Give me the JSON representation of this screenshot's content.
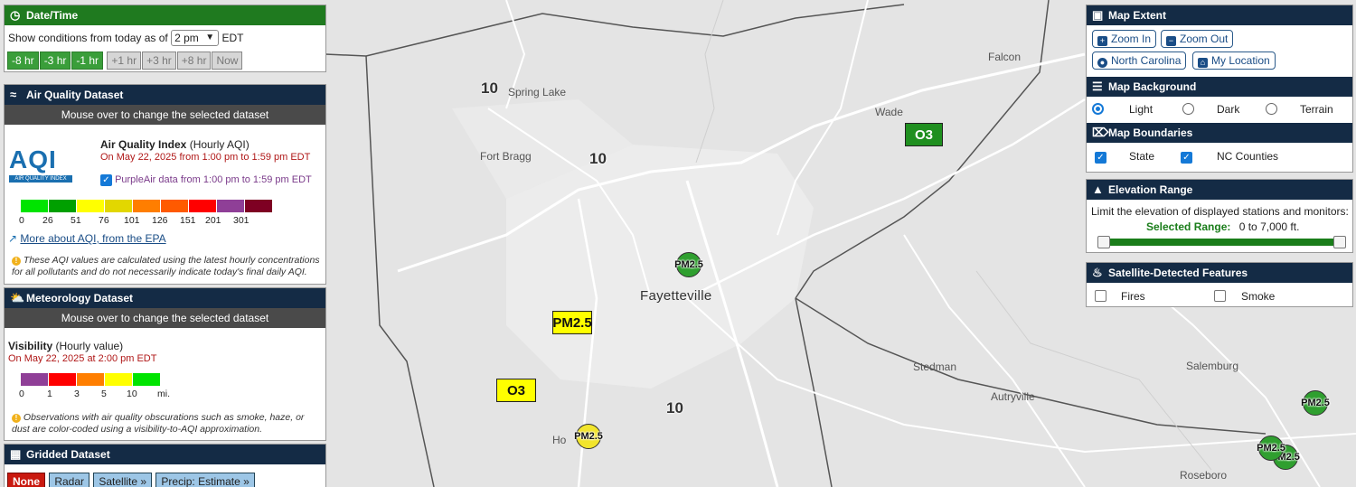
{
  "map": {
    "places": [
      {
        "id": "spring-lake",
        "name": "Spring Lake"
      },
      {
        "id": "fort-bragg",
        "name": "Fort Bragg"
      },
      {
        "id": "fayetteville",
        "name": "Fayetteville"
      },
      {
        "id": "wade",
        "name": "Wade"
      },
      {
        "id": "falcon",
        "name": "Falcon"
      },
      {
        "id": "stedman",
        "name": "Stedman"
      },
      {
        "id": "autryville",
        "name": "Autryville"
      },
      {
        "id": "salemburg",
        "name": "Salemburg"
      },
      {
        "id": "roseboro",
        "name": "Roseboro"
      },
      {
        "id": "hope-mills",
        "name": "Ho"
      }
    ],
    "route_shields": [
      "10",
      "10",
      "10"
    ],
    "markers": [
      {
        "label": "O3",
        "color": "#1f8f1f",
        "shape": "square"
      },
      {
        "label": "PM2.5",
        "color": "#ffff00",
        "shape": "square"
      },
      {
        "label": "O3",
        "color": "#ffff00",
        "shape": "square"
      },
      {
        "label": "PM2.5",
        "color": "#2f9f2f",
        "shape": "circle"
      },
      {
        "label": "PM2.5",
        "color": "#f2e52c",
        "shape": "circle"
      },
      {
        "label": "PM2.5",
        "color": "#2f9f2f",
        "shape": "circle"
      },
      {
        "label": "PM2.5",
        "color": "#2f9f2f",
        "shape": "circle"
      },
      {
        "label": "PM2.5",
        "color": "#2f9f2f",
        "shape": "circle"
      }
    ]
  },
  "datetime": {
    "title": "Date/Time",
    "show_label": "Show conditions from today as of",
    "selected_time": "2 pm",
    "timezone": "EDT",
    "buttons": [
      "-8 hr",
      "-3 hr",
      "-1 hr",
      "+1 hr",
      "+3 hr",
      "+8 hr",
      "Now"
    ]
  },
  "aq": {
    "title": "Air Quality Dataset",
    "hint": "Mouse over to change the selected dataset",
    "logo_text": "AQI",
    "logo_sub": "AIR QUALITY INDEX",
    "name_bold": "Air Quality Index",
    "name_rest": "(Hourly AQI)",
    "date_line": "On May 22, 2025 from 1:00 pm to 1:59 pm EDT",
    "purpleair_link": "PurpleAir",
    "purpleair_rest": "data from 1:00 pm to 1:59 pm EDT",
    "scale_colors": [
      "#00e400",
      "#00a000",
      "#ffff00",
      "#e2d700",
      "#ff7e00",
      "#ff5a00",
      "#ff0000",
      "#8f3f97",
      "#7e0023"
    ],
    "scale_ticks": [
      "0",
      "26",
      "51",
      "76",
      "101",
      "126",
      "151",
      "201",
      "301"
    ],
    "epa_link": "More about AQI, from the EPA",
    "note": "These AQI values are calculated using the latest hourly concentrations for all pollutants and do not necessarily indicate today's final daily AQI."
  },
  "met": {
    "title": "Meteorology Dataset",
    "hint": "Mouse over to change the selected dataset",
    "name_bold": "Visibility",
    "name_rest": "(Hourly value)",
    "date_line": "On May 22, 2025 at 2:00 pm EDT",
    "scale_colors": [
      "#8f3f97",
      "#ff0000",
      "#ff7e00",
      "#ffff00",
      "#00e400"
    ],
    "scale_ticks": [
      "0",
      "1",
      "3",
      "5",
      "10",
      "mi."
    ],
    "note": "Observations with air quality obscurations such as smoke, haze, or dust are color-coded using a visibility-to-AQI approximation."
  },
  "grid": {
    "title": "Gridded Dataset",
    "buttons": [
      "None",
      "Radar",
      "Satellite  »",
      "Precip: Estimate  »"
    ]
  },
  "extent": {
    "title": "Map Extent",
    "zoom_in": "Zoom In",
    "zoom_out": "Zoom Out",
    "state": "North Carolina",
    "my_location": "My Location"
  },
  "background": {
    "title": "Map Background",
    "options": [
      "Light",
      "Dark",
      "Terrain"
    ],
    "selected": "Light"
  },
  "boundaries": {
    "title": "Map Boundaries",
    "options": [
      "State",
      "NC Counties"
    ]
  },
  "elevation": {
    "title": "Elevation Range",
    "desc": "Limit the elevation of displayed stations and monitors:",
    "selected_label": "Selected Range:",
    "selected_value": "0 to 7,000 ft."
  },
  "satellite": {
    "title": "Satellite-Detected Features",
    "options": [
      "Fires",
      "Smoke"
    ]
  }
}
